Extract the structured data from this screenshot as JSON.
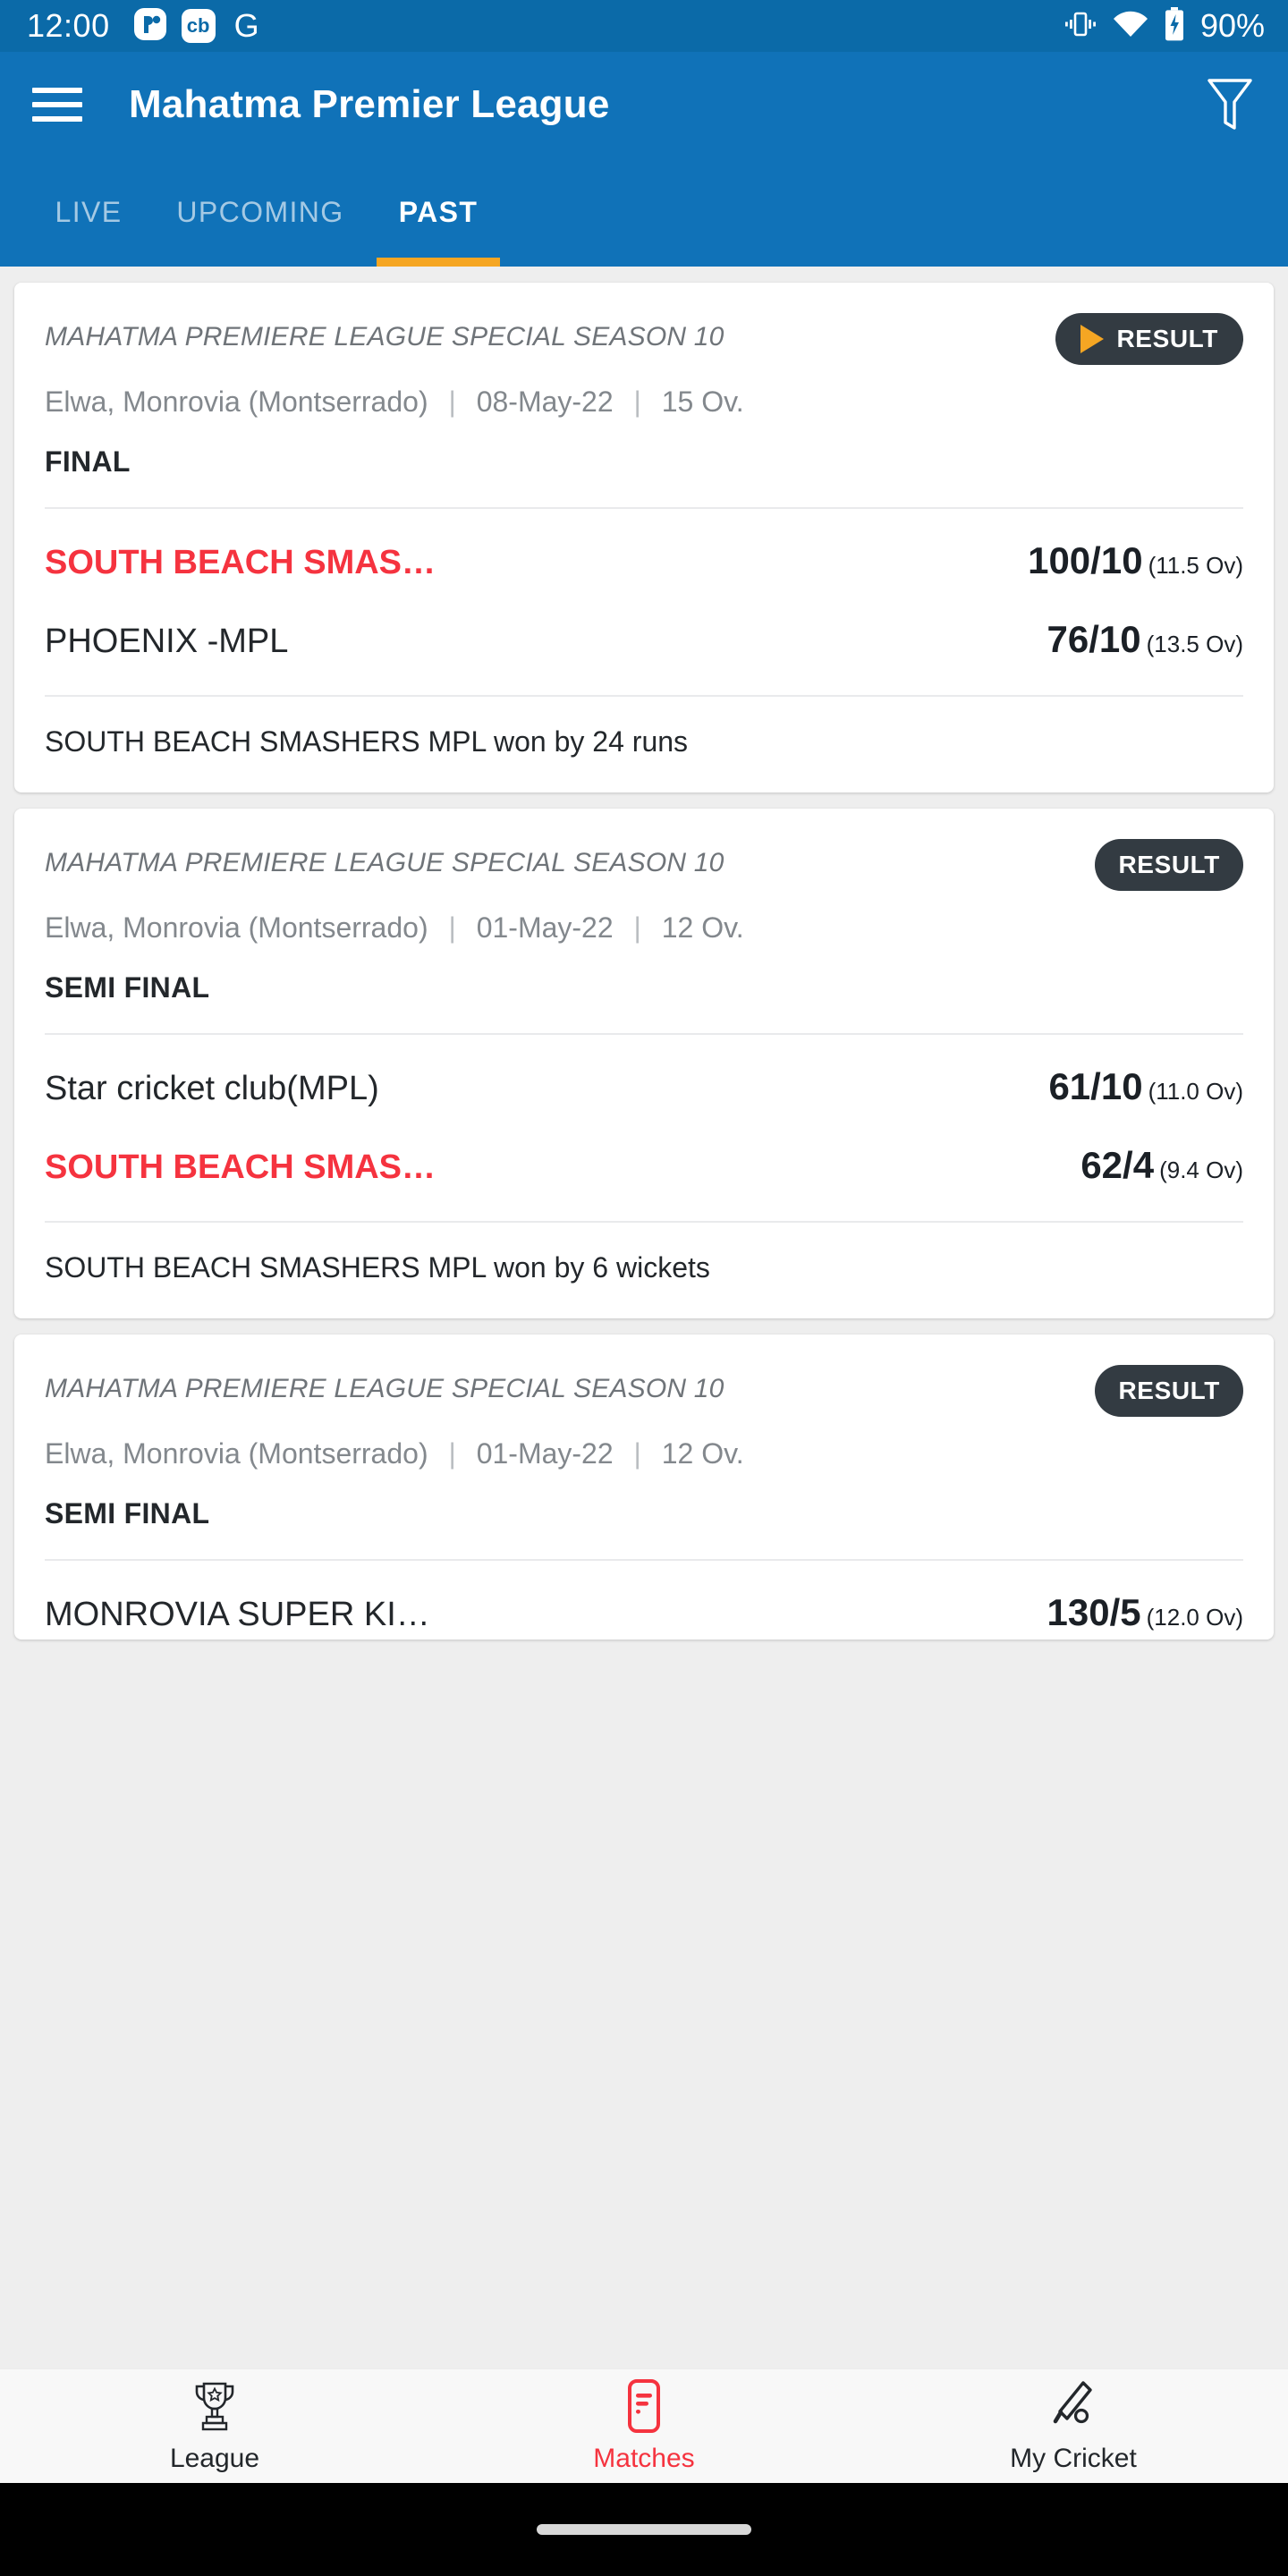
{
  "status_bar": {
    "clock": "12:00",
    "notification_icons": [
      "cricket-app-icon",
      "cricbuzz-icon",
      "google-icon"
    ],
    "cricbuzz_label": "cb",
    "google_label": "G",
    "right_icons": [
      "vibrate-icon",
      "wifi-icon",
      "battery-charging-icon"
    ],
    "battery_percent": "90%"
  },
  "app_bar": {
    "menu_icon": "hamburger-menu-icon",
    "title": "Mahatma Premier League",
    "filter_icon": "filter-funnel-icon"
  },
  "tabs": {
    "items": [
      {
        "label": "LIVE",
        "active": false
      },
      {
        "label": "UPCOMING",
        "active": false
      },
      {
        "label": "PAST",
        "active": true
      }
    ],
    "active_index": 2,
    "indicator_color": "#f5a623"
  },
  "matches": [
    {
      "league": "MAHATMA PREMIERE LEAGUE SPECIAL SEASON 10",
      "badge": "RESULT",
      "badge_has_play_icon": true,
      "venue": "Elwa, Monrovia (Montserrado)",
      "date": "08-May-22",
      "overs": "15 Ov.",
      "stage": "FINAL",
      "teams": [
        {
          "name": "SOUTH BEACH SMAS…",
          "score": "100/10",
          "overs": "(11.5 Ov)",
          "winner": true
        },
        {
          "name": "PHOENIX -MPL",
          "score": "76/10",
          "overs": "(13.5 Ov)",
          "winner": false
        }
      ],
      "result": "SOUTH BEACH SMASHERS MPL won by 24 runs"
    },
    {
      "league": "MAHATMA PREMIERE LEAGUE SPECIAL SEASON 10",
      "badge": "RESULT",
      "badge_has_play_icon": false,
      "venue": "Elwa, Monrovia (Montserrado)",
      "date": "01-May-22",
      "overs": "12 Ov.",
      "stage": "SEMI FINAL",
      "teams": [
        {
          "name": "Star cricket club(MPL)",
          "score": "61/10",
          "overs": "(11.0 Ov)",
          "winner": false
        },
        {
          "name": "SOUTH BEACH SMAS…",
          "score": "62/4",
          "overs": "(9.4 Ov)",
          "winner": true
        }
      ],
      "result": "SOUTH BEACH SMASHERS MPL won by 6 wickets"
    },
    {
      "league": "MAHATMA PREMIERE LEAGUE SPECIAL SEASON 10",
      "badge": "RESULT",
      "badge_has_play_icon": false,
      "venue": "Elwa, Monrovia (Montserrado)",
      "date": "01-May-22",
      "overs": "12 Ov.",
      "stage": "SEMI FINAL",
      "teams": [
        {
          "name": "MONROVIA SUPER KI…",
          "score": "130/5",
          "overs": "(12.0 Ov)",
          "winner": false
        }
      ],
      "result": ""
    }
  ],
  "separator": "|",
  "bottom_nav": {
    "items": [
      {
        "label": "League",
        "icon": "trophy-icon",
        "active": false
      },
      {
        "label": "Matches",
        "icon": "match-list-icon",
        "active": true
      },
      {
        "label": "My Cricket",
        "icon": "cricket-bat-ball-icon",
        "active": false
      }
    ],
    "active_index": 1,
    "active_color": "#f5333f",
    "inactive_color": "#23272b"
  },
  "colors": {
    "status_bar": "#0b6aa8",
    "app_bar": "#1072b8",
    "accent_orange": "#f5a623",
    "winner_red": "#f5333f",
    "badge_dark": "#333b42",
    "page_bg": "#eeeeee"
  }
}
